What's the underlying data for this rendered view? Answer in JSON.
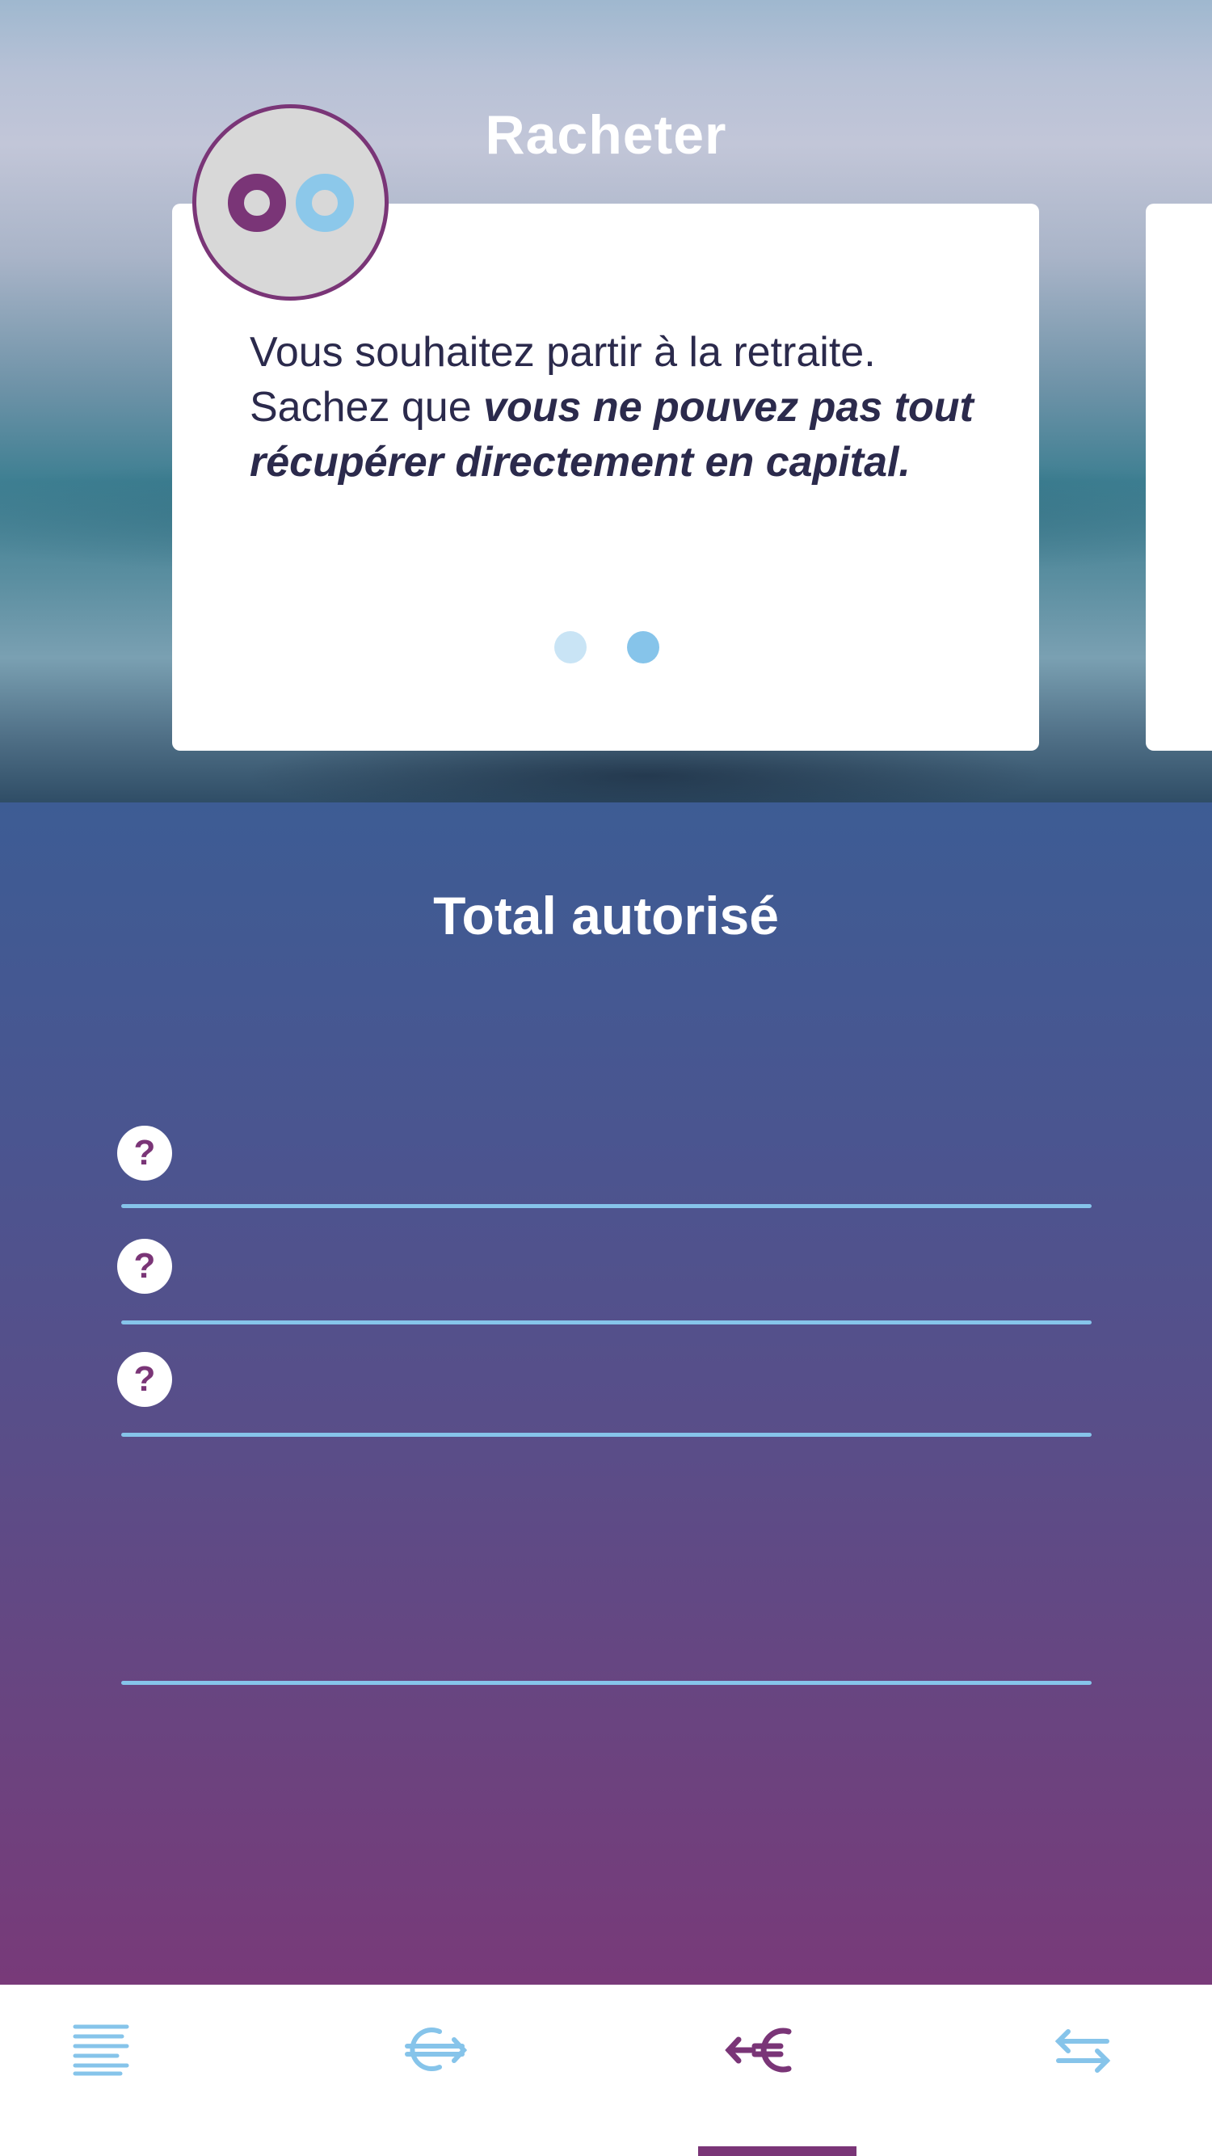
{
  "hero": {
    "title": "Racheter",
    "card": {
      "text_regular": "Vous souhaitez partir à la retraite. Sachez que ",
      "text_emphasis": "vous ne pouvez pas tout récupérer directement en capital.",
      "pager": {
        "count": 2,
        "active_index": 1
      }
    }
  },
  "panel": {
    "title": "Total autorisé",
    "rows": [
      {
        "help_label": "?"
      },
      {
        "help_label": "?"
      },
      {
        "help_label": "?"
      }
    ]
  },
  "nav": {
    "items": [
      {
        "icon": "list-lines-icon",
        "active": false
      },
      {
        "icon": "euro-exchange-icon",
        "active": false
      },
      {
        "icon": "euro-withdraw-icon",
        "active": true
      },
      {
        "icon": "transfer-arrows-icon",
        "active": false
      }
    ]
  },
  "colors": {
    "accent_purple": "#7a3577",
    "accent_light_blue": "#86c4ea",
    "text_dark": "#2b2a4c",
    "panel_top": "#3d5c94",
    "panel_bottom": "#783a79"
  }
}
